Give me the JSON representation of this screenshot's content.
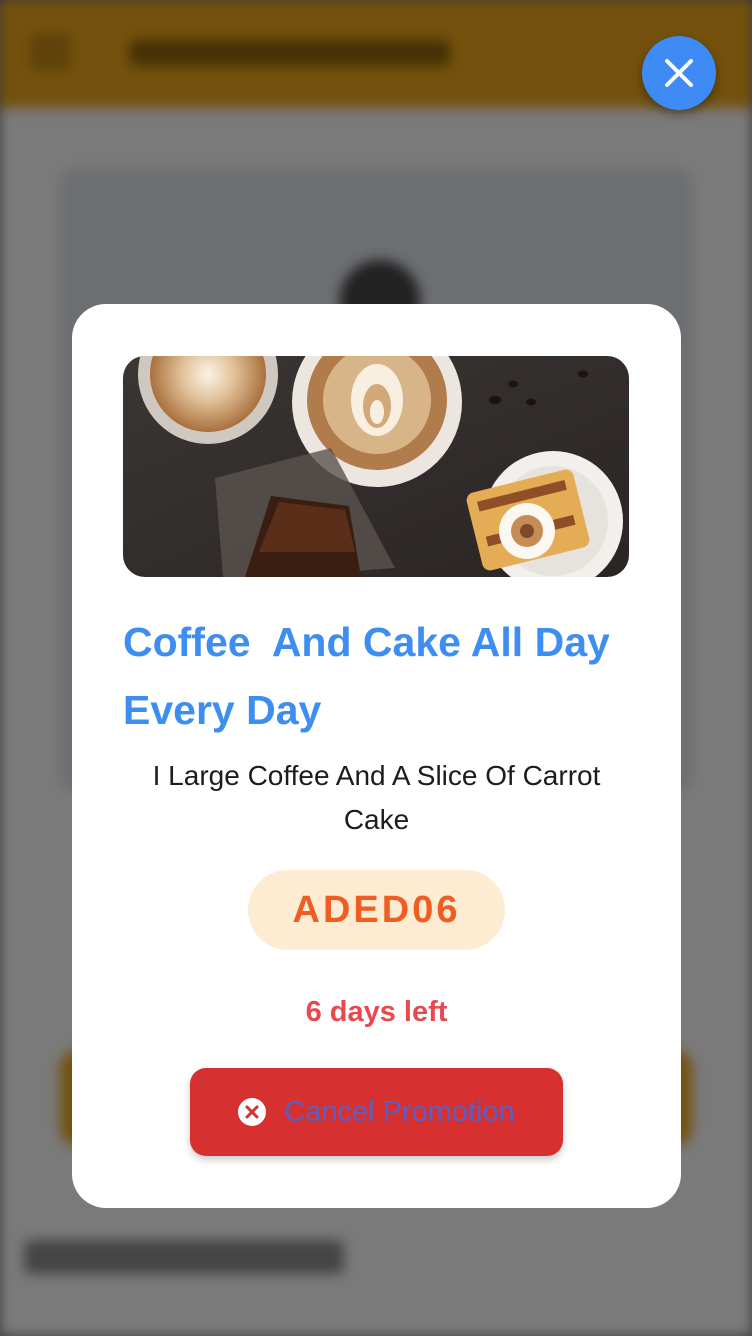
{
  "close": {
    "icon": "close-icon"
  },
  "promotion": {
    "title": "Coffee  And Cake All Day Every Day",
    "description": "I Large Coffee And A Slice Of Carrot Cake",
    "code": "ADED06",
    "days_left": "6 days left",
    "cancel_label": "Cancel Promotion",
    "cancel_icon": "cancel-circle-icon",
    "image_icon": "coffee-and-cake-photo"
  },
  "colors": {
    "title": "#3d8ef0",
    "code_text": "#ef5d22",
    "code_bg": "#fdebd2",
    "days_left": "#e8494f",
    "cancel_bg": "#d63031",
    "close_bg": "#3e8bf5"
  }
}
